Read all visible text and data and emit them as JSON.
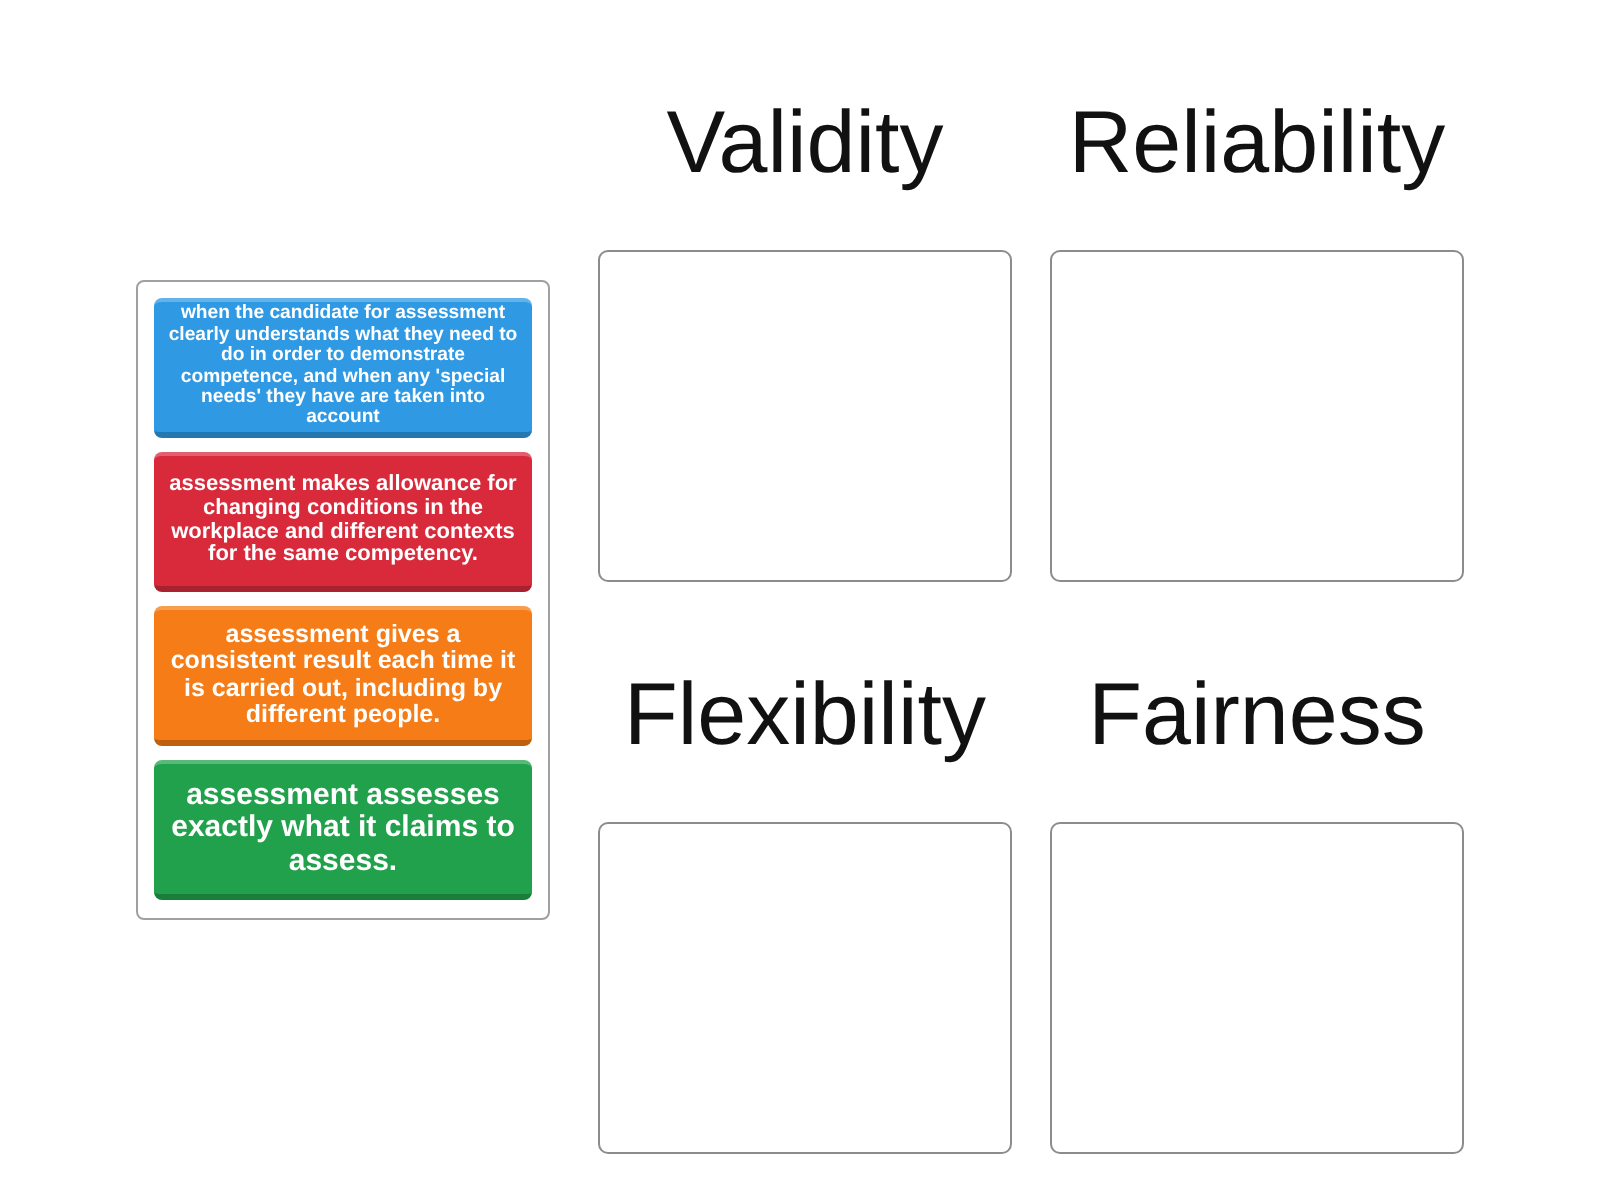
{
  "source_cards": [
    {
      "text": "when the candidate for assessment clearly understands what they need to do in order to demonstrate competence, and when any 'special needs' they have are taken into account",
      "color": "#2f9ae3"
    },
    {
      "text": "assessment makes allowance for changing conditions in the workplace and different contexts for the same competency.",
      "color": "#d92a3c"
    },
    {
      "text": "assessment gives a consistent result each time it is carried out, including by different people.",
      "color": "#f57c16"
    },
    {
      "text": "assessment assesses exactly what it claims to assess.",
      "color": "#22a14c"
    }
  ],
  "categories": [
    {
      "title": "Validity"
    },
    {
      "title": "Reliability"
    },
    {
      "title": "Flexibility"
    },
    {
      "title": "Fairness"
    }
  ]
}
